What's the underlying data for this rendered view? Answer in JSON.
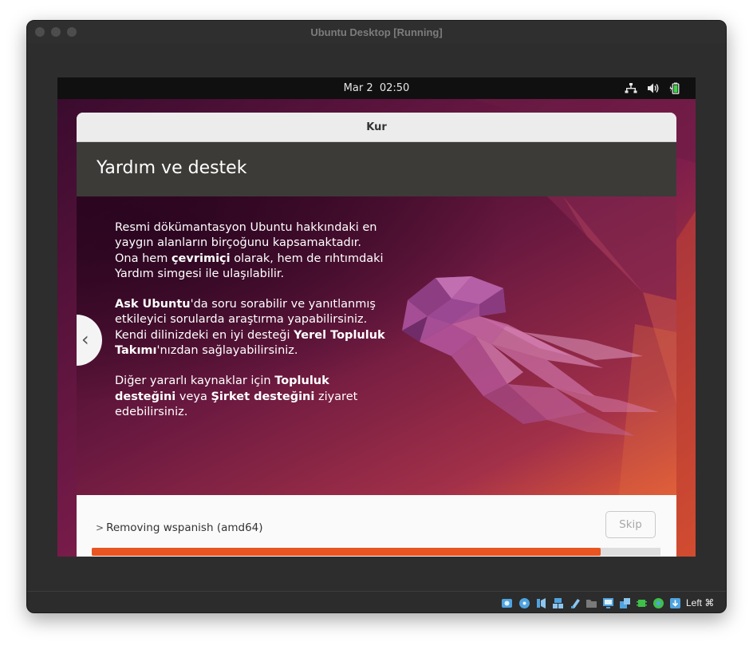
{
  "window": {
    "title": "Ubuntu Desktop [Running]"
  },
  "topbar": {
    "date": "Mar 2",
    "time": "02:50",
    "tray_icons": [
      "network-icon",
      "volume-icon",
      "battery-icon"
    ]
  },
  "installer": {
    "title": "Kur",
    "section_title": "Yardım ve destek",
    "slide": {
      "p1_a": "Resmi dökümantasyon Ubuntu hakkındaki en yaygın alanların birçoğunu kapsamaktadır. Ona hem ",
      "p1_b": "çevrimiçi",
      "p1_c": " olarak, hem de rıhtımdaki Yardım simgesi ile ulaşılabilir.",
      "p2_a": "Ask Ubuntu",
      "p2_b": "'da soru sorabilir ve yanıtlanmış etkileyici sorularda araştırma yapabilirsiniz. Kendi dilinizdeki en iyi desteği ",
      "p2_c": "Yerel Topluluk Takımı",
      "p2_d": "'nızdan sağlayabilirsiniz.",
      "p3_a": "Diğer yararlı kaynaklar için ",
      "p3_b": "Topluluk desteğini",
      "p3_c": " veya ",
      "p3_d": "Şirket desteğini",
      "p3_e": " ziyaret edebilirsiniz."
    },
    "prev_icon": "‹",
    "status_text": "Removing wspanish (amd64)",
    "skip_label": "Skip",
    "progress_fraction": 0.895,
    "accent_color": "#e95420"
  },
  "statusbar": {
    "host_key": "Left ⌘",
    "icons": [
      "hard-disk-icon",
      "optical-drive-icon",
      "audio-icon",
      "network-adapter-icon",
      "usb-icon",
      "shared-folders-icon",
      "display-icon",
      "video-capture-icon",
      "cpu-icon",
      "mouse-integration-icon",
      "keyboard-capture-icon"
    ]
  }
}
